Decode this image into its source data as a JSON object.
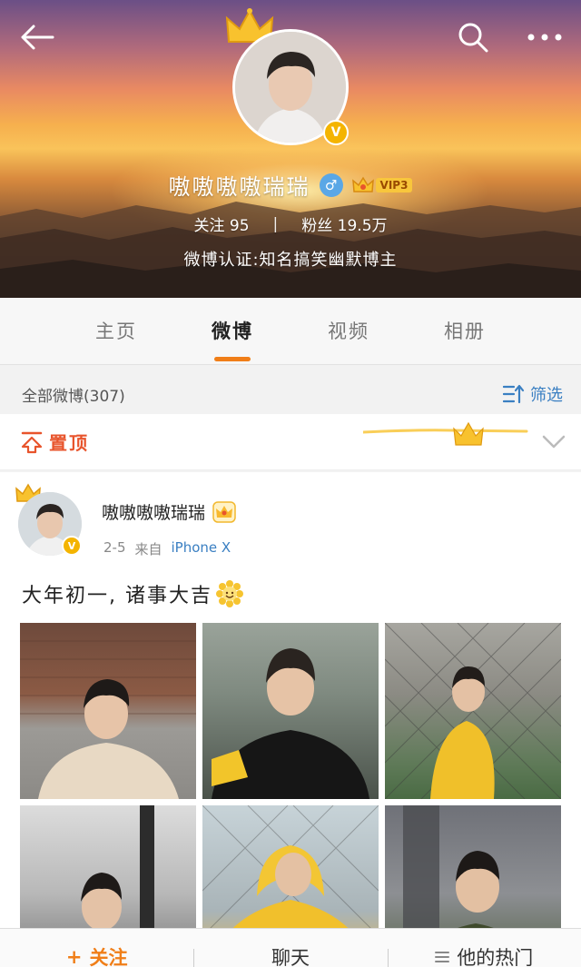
{
  "profile": {
    "name": "嗷嗷嗷嗷瑞瑞",
    "gender_icon": "male-icon",
    "vip_label": "VIP3",
    "following_label": "关注",
    "following_count": "95",
    "followers_label": "粉丝",
    "followers_count": "19.5万",
    "verification": "微博认证:知名搞笑幽默博主"
  },
  "tabs": [
    {
      "label": "主页",
      "active": false
    },
    {
      "label": "微博",
      "active": true
    },
    {
      "label": "视频",
      "active": false
    },
    {
      "label": "相册",
      "active": false
    }
  ],
  "filter": {
    "count_text": "全部微博(307)",
    "filter_label": "筛选"
  },
  "pinned": {
    "label": "置顶"
  },
  "post": {
    "username": "嗷嗷嗷嗷瑞瑞",
    "date": "2-5",
    "source_prefix": "来自",
    "source": "iPhone X",
    "text": "大年初一, 诸事大吉"
  },
  "bottom_bar": {
    "follow_label": "关注",
    "chat_label": "聊天",
    "hot_label": "他的热门"
  },
  "colors": {
    "accent": "#f07e18",
    "link": "#3a7fc2",
    "pinned": "#e8542c",
    "verified": "#f4b400"
  }
}
